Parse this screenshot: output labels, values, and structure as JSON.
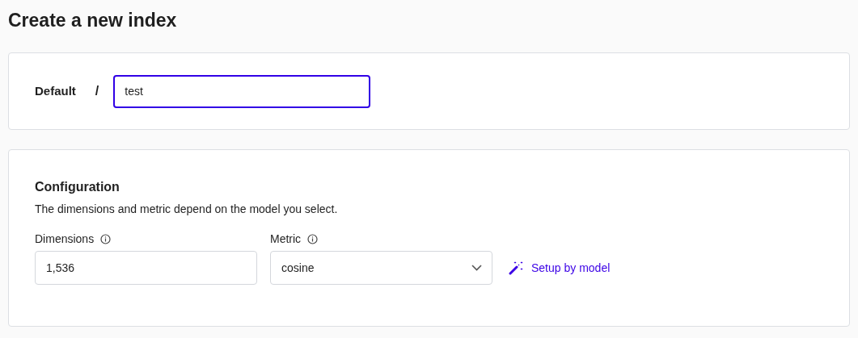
{
  "page_title": "Create a new index",
  "name_card": {
    "namespace": "Default",
    "separator": "/",
    "name_field": {
      "value": "test",
      "focused": true
    }
  },
  "configuration": {
    "title": "Configuration",
    "description": "The dimensions and metric depend on the model you select.",
    "fields": [
      {
        "kind": "input",
        "label": "Dimensions",
        "value": "1,536"
      },
      {
        "kind": "select",
        "label": "Metric",
        "value": "cosine"
      }
    ],
    "setup_link": "Setup by model"
  }
}
